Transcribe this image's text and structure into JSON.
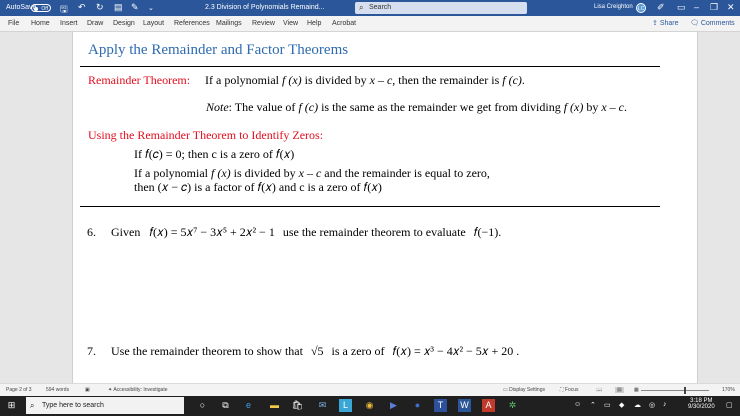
{
  "titlebar": {
    "autosave_label": "AutoSave",
    "autosave_state": "Off",
    "doc_title": "2.3 Division of Polynomials Remaind...",
    "search_placeholder": "Search",
    "user_name": "Lisa Creighton",
    "user_initials": "LC"
  },
  "ribbon": {
    "tabs": [
      "File",
      "Home",
      "Insert",
      "Draw",
      "Design",
      "Layout",
      "References",
      "Mailings",
      "Review",
      "View",
      "Help",
      "Acrobat"
    ],
    "share_label": "Share",
    "comments_label": "Comments"
  },
  "document": {
    "heading": "Apply the Remainder and Factor Theorems",
    "remainder_theorem_label": "Remainder Theorem:",
    "remainder_theorem_text_a": "If a polynomial ",
    "remainder_theorem_fx": "f (x)",
    "remainder_theorem_text_b": " is divided by ",
    "remainder_theorem_xc": "x – c",
    "remainder_theorem_text_c": ", then the remainder is ",
    "remainder_theorem_fc": "f (c)",
    "remainder_theorem_text_d": ".",
    "note_label": "Note",
    "note_text_a": ": The value of ",
    "note_fc": "f (c)",
    "note_text_b": " is the same as the remainder we get from dividing ",
    "note_fx": "f (x)",
    "note_text_c": " by ",
    "note_xc": "x – c",
    "note_text_d": ".",
    "zeros_heading": "Using the Remainder Theorem to Identify Zeros:",
    "zeros_line1": "If 𝑓(𝑐)  =  0; then c is a zero of 𝑓(𝑥)",
    "zeros_line2_a": "If a polynomial ",
    "zeros_line2_fx": "f (x)",
    "zeros_line2_b": " is divided by ",
    "zeros_line2_xc": "x – c",
    "zeros_line2_c": " and the remainder is equal to zero,",
    "zeros_line3": "then (𝑥 − 𝑐) is a factor of 𝑓(𝑥) and c is a zero of 𝑓(𝑥)",
    "problems": [
      {
        "number": "6.",
        "lead": "Given",
        "expr": "𝑓(𝑥) = 5𝑥⁷ − 3𝑥⁵ + 2𝑥² − 1",
        "mid": "use the remainder theorem to evaluate",
        "target": "𝑓(−1)."
      },
      {
        "number": "7.",
        "lead": "Use the remainder theorem to show that",
        "sqrt": "√5",
        "mid": "is a zero of",
        "expr": "𝑓(𝑥) = 𝑥³ − 4𝑥² − 5𝑥 + 20 ."
      }
    ]
  },
  "statusbar": {
    "page": "Page 2 of 3",
    "words": "594 words",
    "accessibility": "Accessibility: Investigate",
    "display_settings": "Display Settings",
    "focus": "Focus",
    "zoom": "170%"
  },
  "taskbar": {
    "search_placeholder": "Type here to search",
    "time": "3:18 PM",
    "date": "9/30/2020"
  },
  "colors": {
    "word_blue": "#2b579a",
    "theorem_red": "#e30e1e",
    "heading_blue": "#2e6bb0"
  }
}
